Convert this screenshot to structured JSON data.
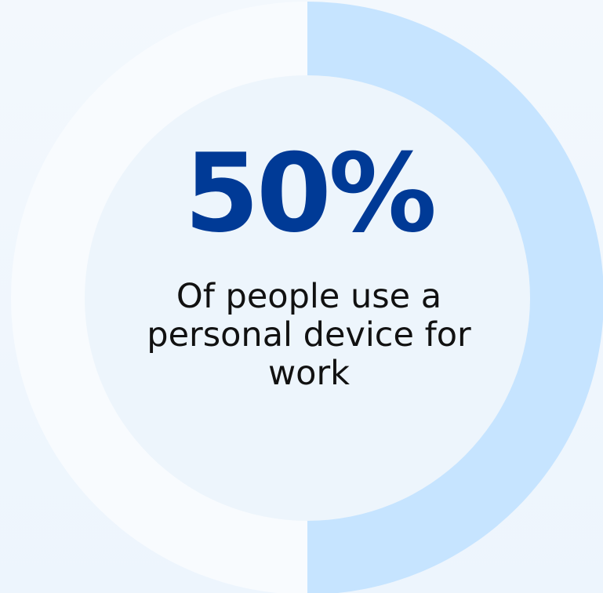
{
  "colors": {
    "background": "#f3f8fd",
    "track": "#f8fbfe",
    "filled_arc": "#c6e4ff",
    "inner_circle": "#edf5fc",
    "percent_text": "#003a96",
    "caption_text": "#111111"
  },
  "chart_data": {
    "type": "pie",
    "values": [
      50,
      50
    ],
    "value_label": "50%",
    "caption": "Of people use a personal device for work",
    "colors": [
      "#c6e4ff",
      "#f8fbfe"
    ],
    "start": "top",
    "direction": "clockwise"
  }
}
